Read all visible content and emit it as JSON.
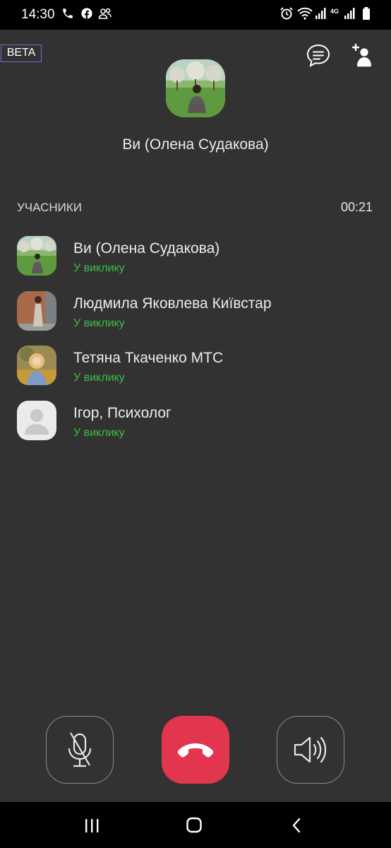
{
  "status_bar": {
    "time": "14:30",
    "network": "4G",
    "icons": [
      "phone-icon",
      "facebook-icon",
      "people-icon",
      "alarm-icon",
      "wifi-icon",
      "signal-icon",
      "signal-icon",
      "battery-icon"
    ]
  },
  "header": {
    "badge": "BETA",
    "chat_icon": "chat-bubble-icon",
    "add_icon": "add-participant-icon"
  },
  "caller": {
    "name": "Ви (Олена Судакова)"
  },
  "participants": {
    "section_label": "УЧАСНИКИ",
    "duration": "00:21",
    "items": [
      {
        "name": "Ви (Олена Судакова)",
        "status": "У виклику"
      },
      {
        "name": "Людмила Яковлева Київстар",
        "status": "У виклику"
      },
      {
        "name": "Тетяна Ткаченко МТС",
        "status": "У виклику"
      },
      {
        "name": "Ігор, Психолог",
        "status": "У виклику"
      }
    ]
  },
  "controls": {
    "mute_icon": "microphone-off-icon",
    "end_icon": "end-call-icon",
    "speaker_icon": "speaker-icon"
  },
  "nav": {
    "icons": [
      "recent-apps-icon",
      "home-icon",
      "back-icon"
    ]
  },
  "colors": {
    "background": "#323232",
    "accent": "#7b68d6",
    "status_green": "#3bbf45",
    "end_call": "#e2364f"
  }
}
